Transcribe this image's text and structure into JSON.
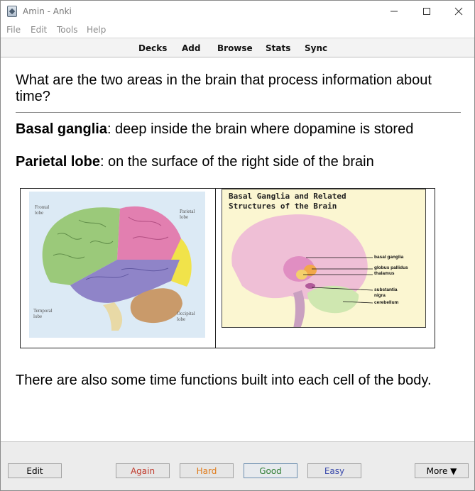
{
  "window": {
    "title": "Amin - Anki"
  },
  "menu": [
    "File",
    "Edit",
    "Tools",
    "Help"
  ],
  "toolbar": [
    "Decks",
    "Add",
    "Browse",
    "Stats",
    "Sync"
  ],
  "card": {
    "question": "What are the two areas in the brain that process information about time?",
    "answers": [
      {
        "term": "Basal ganglia",
        "text": ": deep inside the brain where dopamine is stored"
      },
      {
        "term": "Parietal lobe",
        "text": ": on the surface of the right side of the brain"
      }
    ],
    "image1": {
      "labels": {
        "frontal": "Frontal\nlobe",
        "parietal": "Parietal\nlobe",
        "temporal": "Temporal\nlobe",
        "occipital": "Occipital\nlobe"
      }
    },
    "image2": {
      "title": "Basal Ganglia and Related\nStructures of the Brain",
      "labels": [
        "basal ganglia",
        "globus pallidus",
        "thalamus",
        "substantia",
        "nigra",
        "cerebellum"
      ]
    },
    "footnote": "There are also some time functions built into each cell of the body."
  },
  "reviewer": {
    "edit": "Edit",
    "again": "Again",
    "hard": "Hard",
    "good": "Good",
    "easy": "Easy",
    "more": "More ▼"
  },
  "colors": {
    "again": "#c0392b",
    "hard": "#e07b1a",
    "good": "#2e7d32",
    "easy": "#3949ab"
  }
}
